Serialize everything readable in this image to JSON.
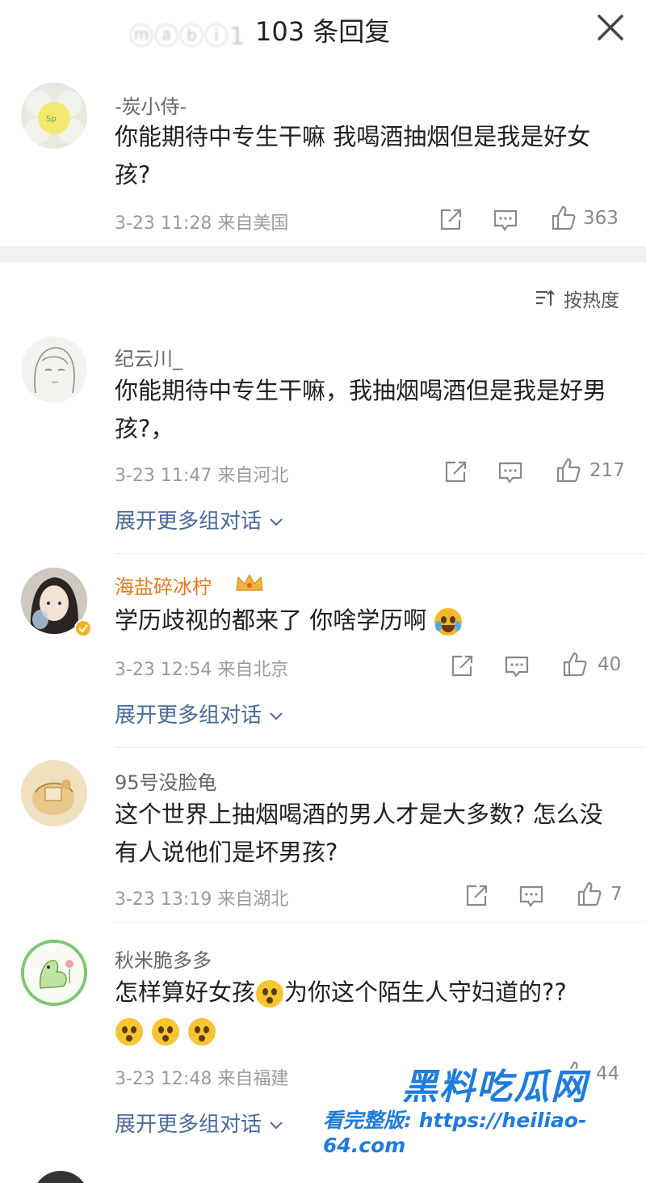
{
  "header": {
    "blurred_name": "ⓜⓐⓑⓘ1",
    "title": "103 条回复"
  },
  "top_comment": {
    "username": "-炭小侍-",
    "text": "你能期待中专生干嘛 我喝酒抽烟但是我是好女孩?",
    "time": "3-23 11:28",
    "location": "来自美国",
    "likes": "363"
  },
  "sort": {
    "label": "按热度"
  },
  "replies": [
    {
      "username": "纪云川_",
      "text": "你能期待中专生干嘛，我抽烟喝酒但是我是好男孩?，",
      "time": "3-23 11:47",
      "location": "来自河北",
      "likes": "217",
      "expand": "展开更多组对话"
    },
    {
      "username": "海盐碎冰柠",
      "text": "学历歧视的都来了 你啥学历啊",
      "time": "3-23 12:54",
      "location": "来自北京",
      "likes": "40",
      "expand": "展开更多组对话"
    },
    {
      "username": "95号没脸龟",
      "text": "这个世界上抽烟喝酒的男人才是大多数? 怎么没有人说他们是坏男孩?",
      "time": "3-23 13:19",
      "location": "来自湖北",
      "likes": "7"
    },
    {
      "username": "秋米脆多多",
      "text_a": "怎样算好女孩",
      "text_b": "为你这个陌生人守妇道的??",
      "time": "3-23 12:48",
      "location": "来自福建",
      "likes": "44",
      "expand": "展开更多组对话"
    }
  ],
  "watermark": {
    "brand": "黑料吃瓜网",
    "line2": "看完整版: https://heiliao-64.com"
  },
  "colors": {
    "vip_name": "#e9781a",
    "expand_link": "#4a6a9a",
    "watermark": "#1e7be0"
  }
}
